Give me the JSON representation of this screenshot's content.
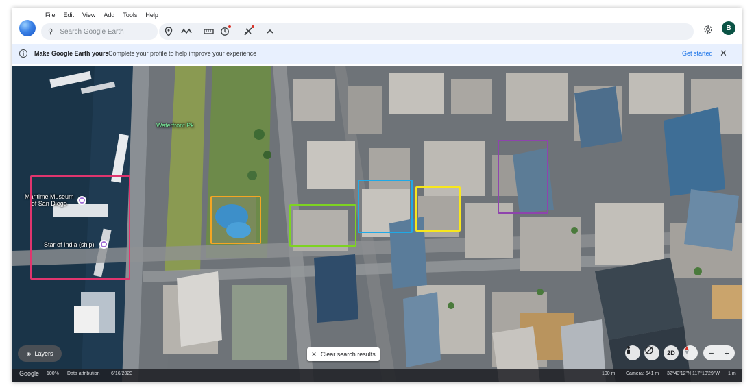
{
  "menu": [
    "File",
    "Edit",
    "View",
    "Add",
    "Tools",
    "Help"
  ],
  "search": {
    "placeholder": "Search Google Earth"
  },
  "toolbar": {
    "icons": [
      "place-pin-icon",
      "path-icon",
      "measure-ruler-icon",
      "history-icon",
      "project-icon",
      "collapse-chevron-icon"
    ]
  },
  "account": {
    "initial": "B",
    "color": "#0b5345"
  },
  "banner": {
    "title": "Make Google Earth yours",
    "text": "Complete your profile to help improve your experience",
    "link": "Get started"
  },
  "map": {
    "labels": {
      "waterfront": "Waterfront Pk",
      "maritime": "Maritime Museum of San Diego",
      "maritime_line1": "Maritime Museum",
      "maritime_line2": "of San Diego",
      "star": "Star of India (ship)"
    },
    "highlight_colors": {
      "pink": "#e0356e",
      "orange": "#f5a623",
      "green": "#7ed321",
      "blue": "#1fa9e6",
      "yellow": "#f8e71c",
      "purple": "#8e44ad"
    }
  },
  "controls": {
    "layers": "Layers",
    "clear": "Clear search results",
    "view_2d": "2D"
  },
  "status": {
    "brand": "Google",
    "zoom_pct": "100%",
    "attribution": "Data attribution",
    "date": "6/16/2023",
    "scale": "100 m",
    "camera": "Camera: 641 m",
    "coords": "32°43'12\"N 117°10'29\"W",
    "elev": "1 m"
  }
}
